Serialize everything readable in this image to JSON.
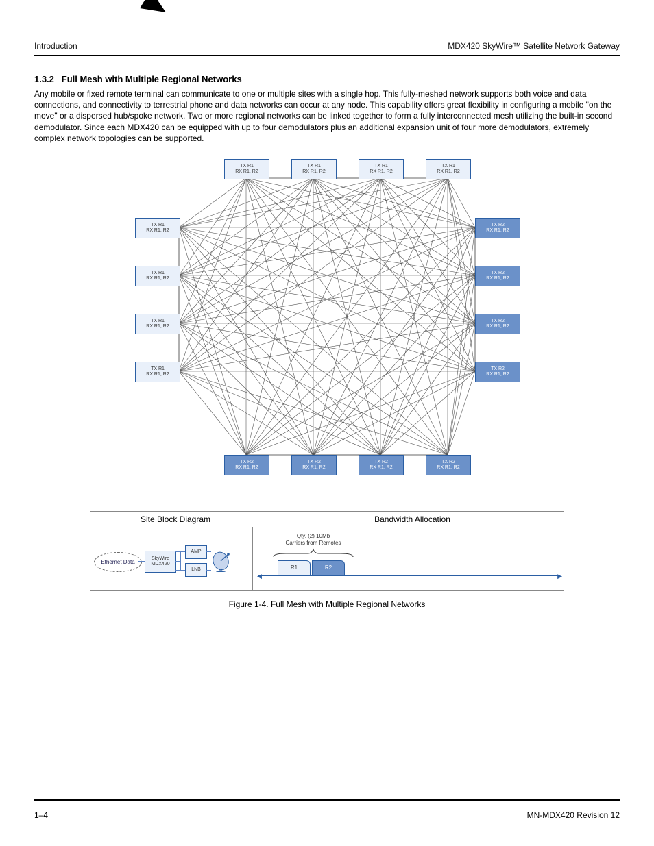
{
  "header": {
    "left": "Introduction",
    "right": "MDX420 SkyWire™ Satellite Network Gateway"
  },
  "section": {
    "number": "1.3.2",
    "title": "Full Mesh with Multiple Regional Networks",
    "body": "Any mobile or fixed remote terminal can communicate to one or multiple sites with a single hop. This fully-meshed network supports both voice and data connections, and connectivity to terrestrial phone and data networks can occur at any node. This capability offers great flexibility in configuring a mobile \"on the move\" or a dispersed hub/spoke network. Two or more regional networks can be linked together to form a fully interconnected mesh utilizing the built-in second demodulator. Since each MDX420 can be equipped with up to four demodulators plus an additional expansion unit of four more demodulators, extremely complex network topologies can be supported."
  },
  "network_nodes": {
    "top": [
      {
        "l1": "TX R1",
        "l2": "RX R1, R2"
      },
      {
        "l1": "TX R1",
        "l2": "RX R1, R2"
      },
      {
        "l1": "TX R1",
        "l2": "RX R1, R2"
      },
      {
        "l1": "TX R1",
        "l2": "RX R1, R2"
      }
    ],
    "left": [
      {
        "l1": "TX R1",
        "l2": "RX R1, R2"
      },
      {
        "l1": "TX R1",
        "l2": "RX R1, R2"
      },
      {
        "l1": "TX R1",
        "l2": "RX R1, R2"
      },
      {
        "l1": "TX R1",
        "l2": "RX R1, R2"
      }
    ],
    "right": [
      {
        "l1": "TX R2",
        "l2": "RX R1, R2"
      },
      {
        "l1": "TX R2",
        "l2": "RX R1, R2"
      },
      {
        "l1": "TX R2",
        "l2": "RX R1, R2"
      },
      {
        "l1": "TX R2",
        "l2": "RX R1, R2"
      }
    ],
    "bottom": [
      {
        "l1": "TX R2",
        "l2": "RX R1, R2"
      },
      {
        "l1": "TX R2",
        "l2": "RX R1, R2"
      },
      {
        "l1": "TX R2",
        "l2": "RX R1, R2"
      },
      {
        "l1": "TX R2",
        "l2": "RX R1, R2"
      }
    ]
  },
  "table": {
    "header_left": "Site Block Diagram",
    "header_right": "Bandwidth Allocation",
    "ethernet": "Ethernet Data",
    "skywire_l1": "SkyWire",
    "skywire_l2": "MDX420",
    "amp": "AMP",
    "lnb": "LNB",
    "bw_label_l1": "Qty. (2) 10Mb",
    "bw_label_l2": "Carriers from Remotes",
    "r1": "R1",
    "r2": "R2"
  },
  "figure_caption": "Figure 1-4. Full Mesh with Multiple Regional Networks",
  "footer": {
    "left": "1–4",
    "right": "MN-MDX420  Revision 12"
  }
}
